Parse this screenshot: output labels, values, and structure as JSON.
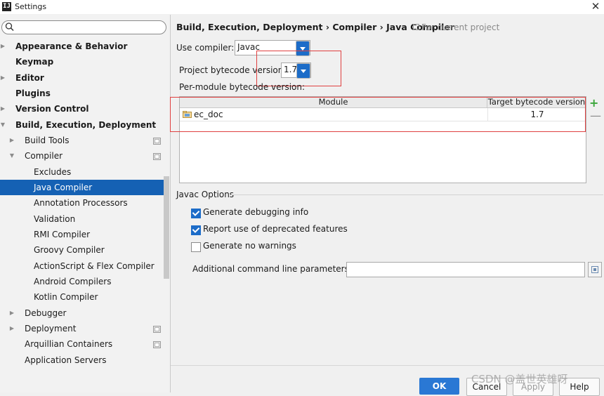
{
  "window": {
    "title": "Settings",
    "icon_text": "IJ"
  },
  "search": {
    "placeholder": ""
  },
  "sidebar": {
    "items": [
      {
        "label": "Appearance & Behavior",
        "indent": 0,
        "arrow": "right",
        "bold": true,
        "badge": false,
        "selected": false
      },
      {
        "label": "Keymap",
        "indent": 0,
        "arrow": "",
        "bold": true,
        "badge": false,
        "selected": false
      },
      {
        "label": "Editor",
        "indent": 0,
        "arrow": "right",
        "bold": true,
        "badge": false,
        "selected": false
      },
      {
        "label": "Plugins",
        "indent": 0,
        "arrow": "",
        "bold": true,
        "badge": false,
        "selected": false
      },
      {
        "label": "Version Control",
        "indent": 0,
        "arrow": "right",
        "bold": true,
        "badge": false,
        "selected": false
      },
      {
        "label": "Build, Execution, Deployment",
        "indent": 0,
        "arrow": "down",
        "bold": true,
        "badge": false,
        "selected": false
      },
      {
        "label": "Build Tools",
        "indent": 1,
        "arrow": "right",
        "bold": false,
        "badge": true,
        "selected": false
      },
      {
        "label": "Compiler",
        "indent": 1,
        "arrow": "down",
        "bold": false,
        "badge": true,
        "selected": false
      },
      {
        "label": "Excludes",
        "indent": 2,
        "arrow": "",
        "bold": false,
        "badge": false,
        "selected": false
      },
      {
        "label": "Java Compiler",
        "indent": 2,
        "arrow": "",
        "bold": false,
        "badge": false,
        "selected": true
      },
      {
        "label": "Annotation Processors",
        "indent": 2,
        "arrow": "",
        "bold": false,
        "badge": false,
        "selected": false
      },
      {
        "label": "Validation",
        "indent": 2,
        "arrow": "",
        "bold": false,
        "badge": false,
        "selected": false
      },
      {
        "label": "RMI Compiler",
        "indent": 2,
        "arrow": "",
        "bold": false,
        "badge": false,
        "selected": false
      },
      {
        "label": "Groovy Compiler",
        "indent": 2,
        "arrow": "",
        "bold": false,
        "badge": false,
        "selected": false
      },
      {
        "label": "ActionScript & Flex Compiler",
        "indent": 2,
        "arrow": "",
        "bold": false,
        "badge": false,
        "selected": false
      },
      {
        "label": "Android Compilers",
        "indent": 2,
        "arrow": "",
        "bold": false,
        "badge": false,
        "selected": false
      },
      {
        "label": "Kotlin Compiler",
        "indent": 2,
        "arrow": "",
        "bold": false,
        "badge": false,
        "selected": false
      },
      {
        "label": "Debugger",
        "indent": 1,
        "arrow": "right",
        "bold": false,
        "badge": false,
        "selected": false
      },
      {
        "label": "Deployment",
        "indent": 1,
        "arrow": "right",
        "bold": false,
        "badge": true,
        "selected": false
      },
      {
        "label": "Arquillian Containers",
        "indent": 1,
        "arrow": "",
        "bold": false,
        "badge": true,
        "selected": false
      },
      {
        "label": "Application Servers",
        "indent": 1,
        "arrow": "",
        "bold": false,
        "badge": false,
        "selected": false
      }
    ]
  },
  "main": {
    "breadcrumb": "Build, Execution, Deployment › Compiler › Java Compiler",
    "for_project": "For current project",
    "use_compiler_label": "Use compiler:",
    "use_compiler_value": "Javac",
    "bytecode_label": "Project bytecode version:",
    "bytecode_value": "1.7",
    "per_module_label": "Per-module bytecode version:",
    "table": {
      "columns": [
        "Module",
        "Target bytecode version"
      ],
      "rows": [
        {
          "module": "ec_doc",
          "target": "1.7"
        }
      ]
    },
    "add_symbol": "+",
    "remove_symbol": "—",
    "javac_options_label": "Javac Options",
    "options": [
      {
        "label": "Generate debugging info",
        "checked": true
      },
      {
        "label": "Report use of deprecated features",
        "checked": true
      },
      {
        "label": "Generate no warnings",
        "checked": false
      }
    ],
    "cmd_label": "Additional command line parameters:",
    "cmd_value": ""
  },
  "buttons": {
    "ok": "OK",
    "cancel": "Cancel",
    "apply": "Apply",
    "help": "Help"
  },
  "watermark": "CSDN @盖世英雄呀",
  "colors": {
    "accent": "#2a78d4",
    "selection": "#1561b4",
    "annotation": "#e04040"
  }
}
